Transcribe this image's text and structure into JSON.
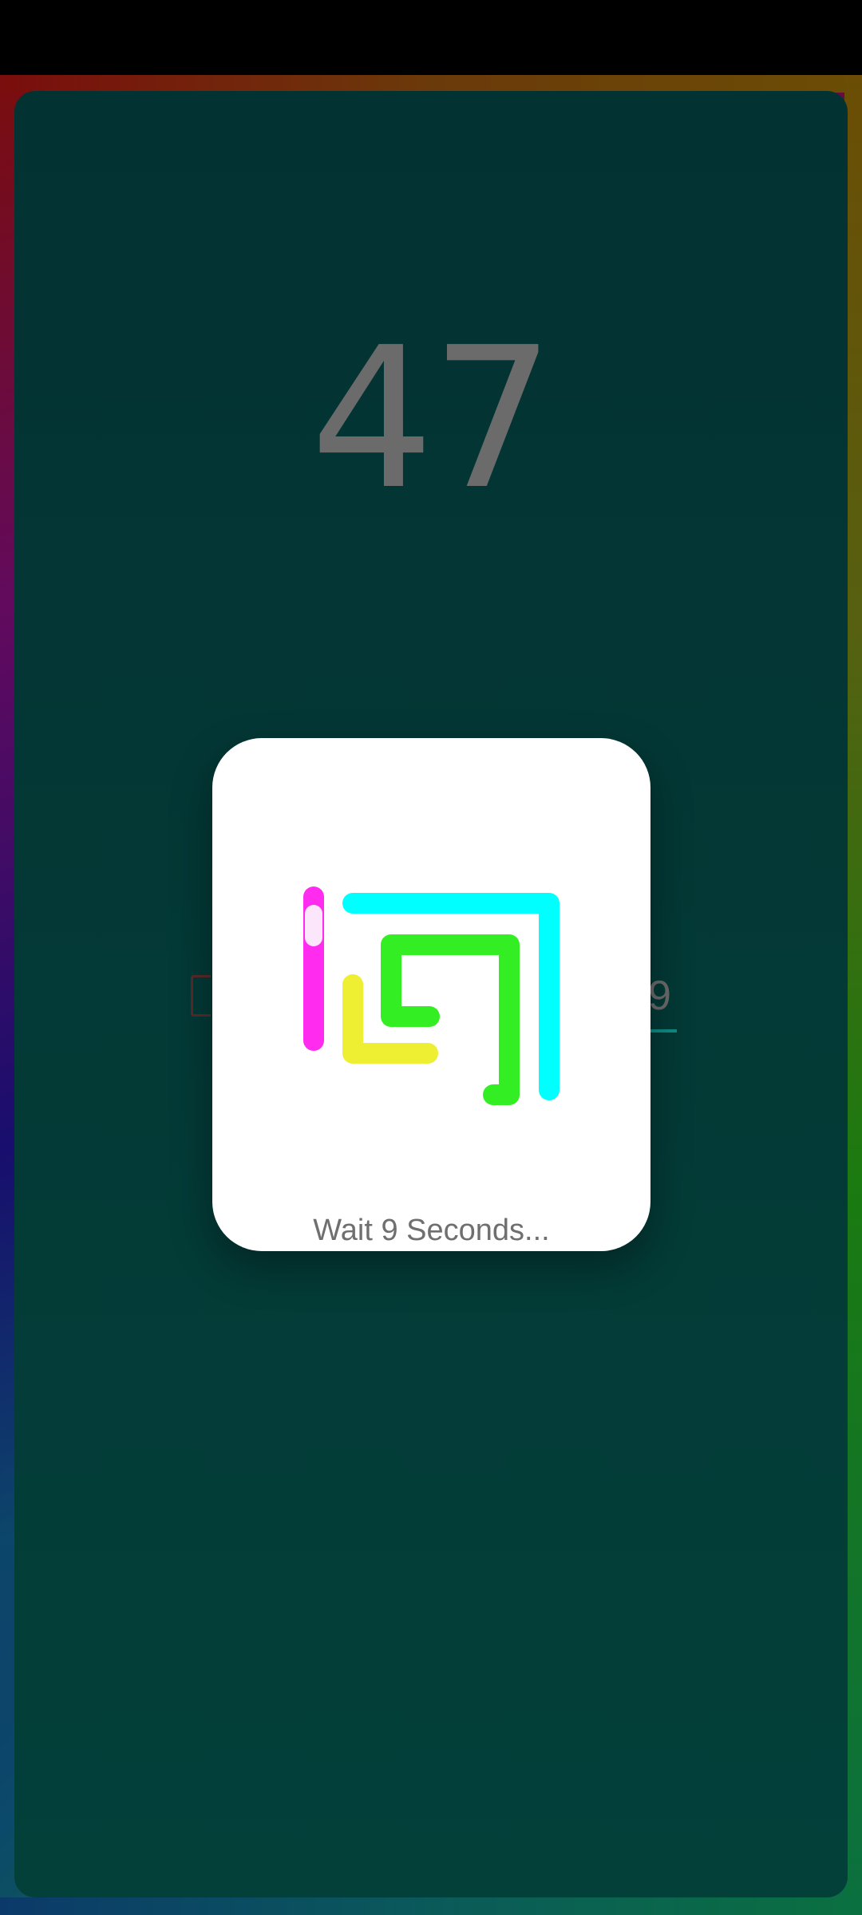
{
  "game": {
    "score": "47"
  },
  "dialog": {
    "wait_text": "Wait 9 Seconds..."
  },
  "background": {
    "partial_digit": "9"
  },
  "colors": {
    "magenta": "#ff2bef",
    "cyan": "#00ffff",
    "green": "#33ee22",
    "yellow": "#eeee33",
    "panel_top": "#033232",
    "panel_bottom": "#03403a"
  },
  "icons": {
    "logo": "spiral-loading-logo"
  }
}
